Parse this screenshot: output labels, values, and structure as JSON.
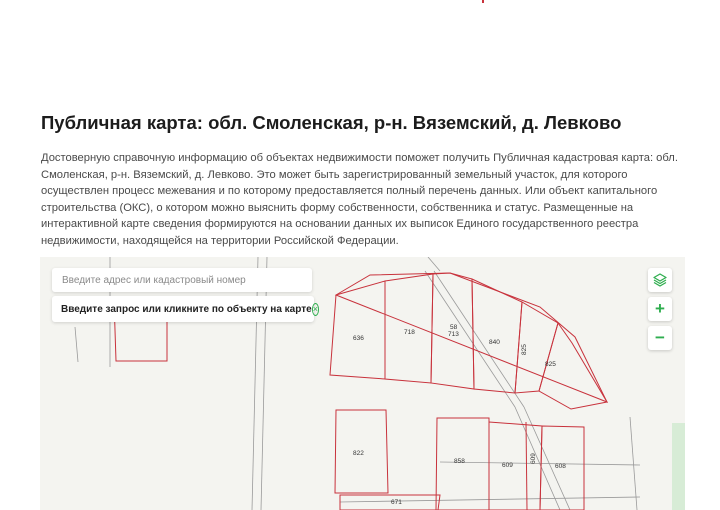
{
  "colors": {
    "accent": "#2fae4f",
    "parcel_border": "#c8323c",
    "map_background": "#f4f4f0",
    "road_line": "#9a9a9a"
  },
  "page": {
    "title": "Публичная карта: обл. Смоленская, р-н. Вяземский, д. Левково",
    "description": "Достоверную справочную информацию об объектах недвижимости поможет получить Публичная кадастровая карта: обл. Смоленская, р-н. Вяземский, д. Левково. Это может быть зарегистрированный земельный участок, для которого осуществлен процесс межевания и по которому предоставляется полный перечень данных. Или объект капитального строительства (ОКС), о котором можно выяснить форму собственности, собственника и статус. Размещенные на интерактивной карте сведения формируются на основании данных их выписок Единого государственного реестра недвижимости, находящейся на территории Российской Федерации."
  },
  "map": {
    "search": {
      "placeholder": "Введите адрес или кадастровый номер",
      "value": ""
    },
    "hint": {
      "text": "Введите запрос или кликните по объекту на карте",
      "close_icon": "×",
      "icon_name": "close-circle-icon"
    },
    "controls": {
      "layers_icon": "layers-icon",
      "zoom_in": "+",
      "zoom_out": "−"
    },
    "plots": [
      {
        "id": "636",
        "label": "636"
      },
      {
        "id": "718",
        "label": "718"
      },
      {
        "id": "58",
        "label": "58"
      },
      {
        "id": "713",
        "label": "713"
      },
      {
        "id": "840",
        "label": "840"
      },
      {
        "id": "825a",
        "label": "825"
      },
      {
        "id": "825b",
        "label": "825"
      },
      {
        "id": "822",
        "label": "822"
      },
      {
        "id": "858",
        "label": "858"
      },
      {
        "id": "609a",
        "label": "609"
      },
      {
        "id": "609b",
        "label": "609"
      },
      {
        "id": "608",
        "label": "608"
      },
      {
        "id": "671",
        "label": "671"
      }
    ]
  }
}
